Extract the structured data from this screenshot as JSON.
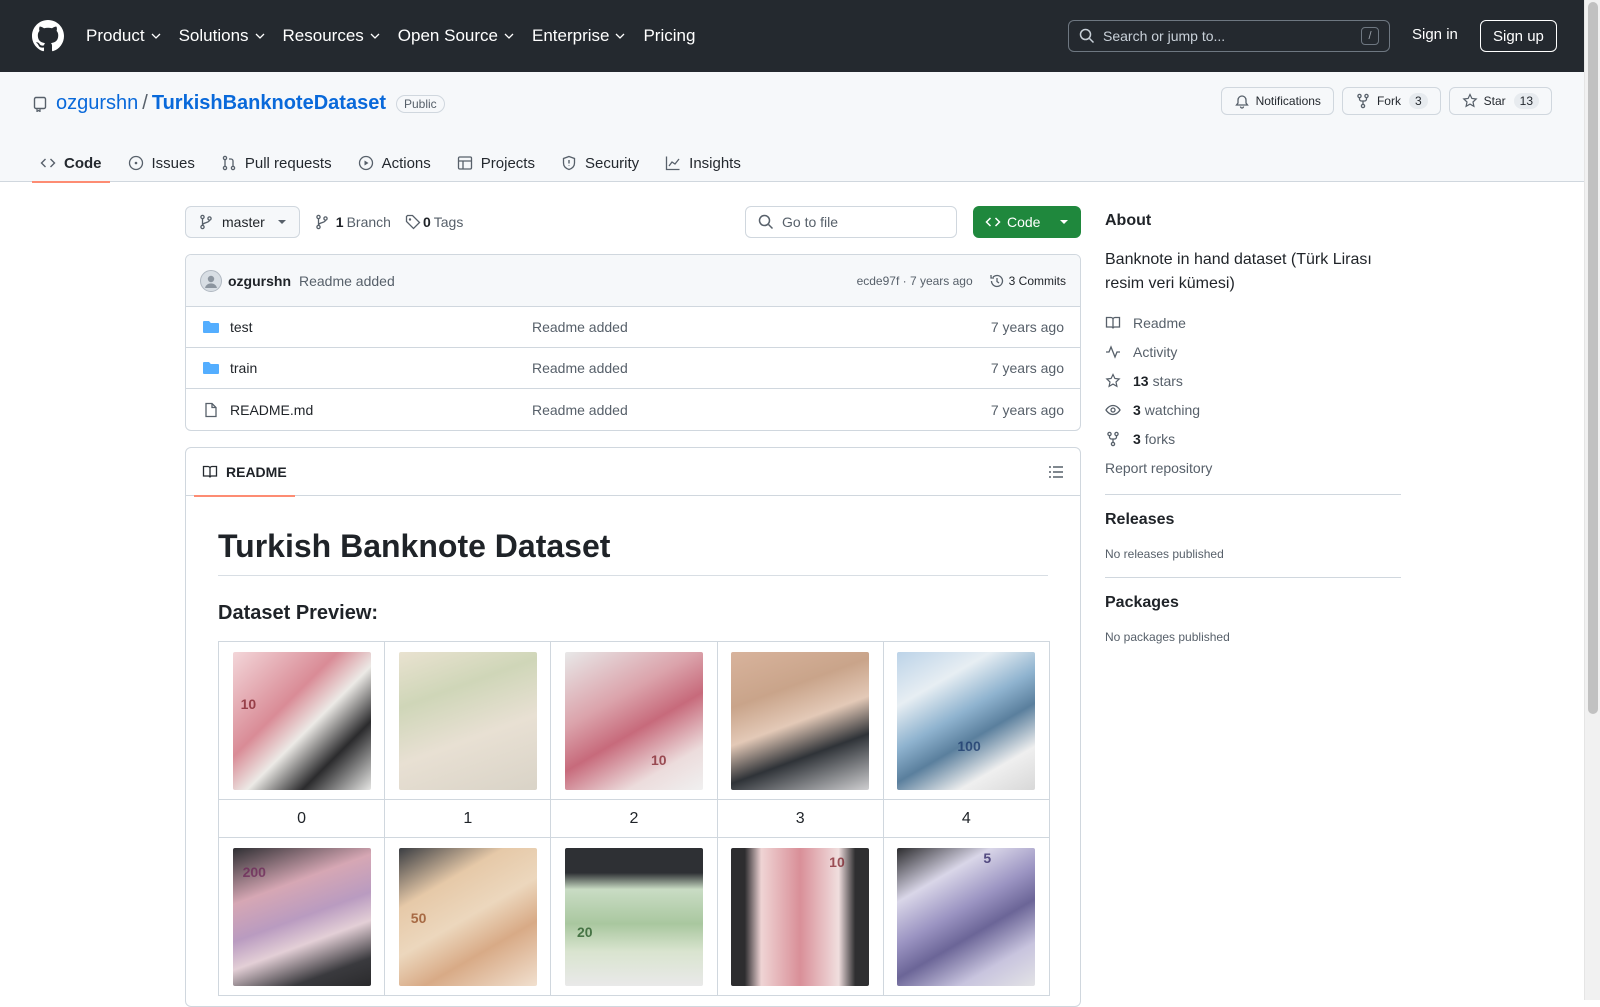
{
  "header": {
    "nav": [
      "Product",
      "Solutions",
      "Resources",
      "Open Source",
      "Enterprise",
      "Pricing"
    ],
    "search_placeholder": "Search or jump to...",
    "search_kbd": "/",
    "signin": "Sign in",
    "signup": "Sign up"
  },
  "repo": {
    "owner": "ozgurshn",
    "separator": "/",
    "name": "TurkishBanknoteDataset",
    "visibility": "Public",
    "notifications": "Notifications",
    "fork_label": "Fork",
    "fork_count": "3",
    "star_label": "Star",
    "star_count": "13"
  },
  "tabs": [
    "Code",
    "Issues",
    "Pull requests",
    "Actions",
    "Projects",
    "Security",
    "Insights"
  ],
  "toolbar": {
    "branch": "master",
    "branch_count": "1",
    "branch_label": "Branch",
    "tag_count": "0",
    "tag_label": "Tags",
    "goto_placeholder": "Go to file",
    "code_button": "Code"
  },
  "commit": {
    "user": "ozgurshn",
    "message": "Readme added",
    "meta": "ecde97f · 7 years ago",
    "commits": "3 Commits"
  },
  "files": [
    {
      "name": "test",
      "type": "folder",
      "message": "Readme added",
      "age": "7 years ago"
    },
    {
      "name": "train",
      "type": "folder",
      "message": "Readme added",
      "age": "7 years ago"
    },
    {
      "name": "README.md",
      "type": "file",
      "message": "Readme added",
      "age": "7 years ago"
    }
  ],
  "readme": {
    "tab": "README",
    "title": "Turkish Banknote Dataset",
    "subtitle": "Dataset Preview:",
    "labels": [
      "0",
      "1",
      "2",
      "3",
      "4"
    ],
    "row1_values": [
      "10",
      "",
      "10",
      "",
      "100"
    ],
    "row2_values": [
      "200",
      "50",
      "20",
      "10",
      "5"
    ]
  },
  "about": {
    "heading": "About",
    "description": "Banknote in hand dataset (Türk Lirası resim veri kümesi)",
    "readme": "Readme",
    "activity": "Activity",
    "stars_count": "13",
    "stars_label": "stars",
    "watching_count": "3",
    "watching_label": "watching",
    "forks_count": "3",
    "forks_label": "forks",
    "report": "Report repository"
  },
  "releases": {
    "heading": "Releases",
    "text": "No releases published"
  },
  "packages": {
    "heading": "Packages",
    "text": "No packages published"
  },
  "colors": {
    "accent": "#0969da",
    "green": "#1f883d",
    "tab_underline": "#fd8c73",
    "header_bg": "#24292f"
  }
}
